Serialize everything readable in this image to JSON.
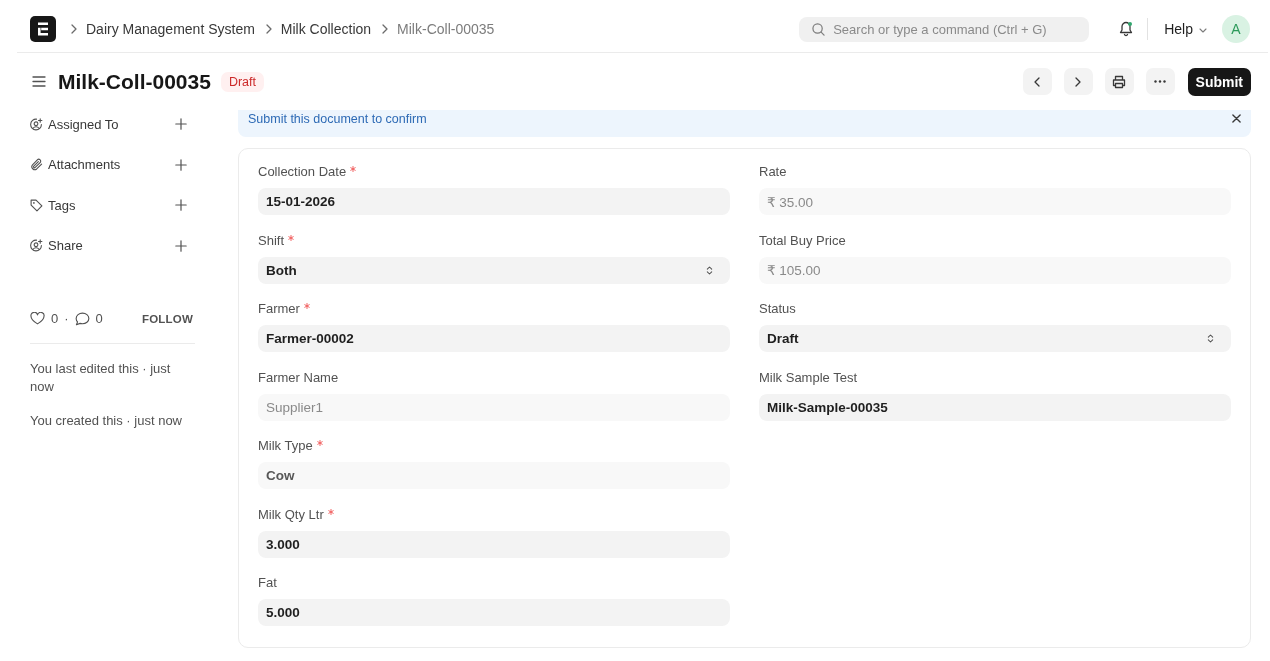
{
  "navbar": {
    "breadcrumbs": [
      {
        "label": "Dairy Management System",
        "current": false
      },
      {
        "label": "Milk Collection",
        "current": false
      },
      {
        "label": "Milk-Coll-00035",
        "current": true
      }
    ],
    "search": {
      "placeholder": "Search or type a command (Ctrl + G)"
    },
    "notifications": {
      "unread": true
    },
    "help": "Help",
    "avatar": "A"
  },
  "page_head": {
    "title": "Milk-Coll-00035",
    "status": "Draft",
    "primary_action": "Submit"
  },
  "sidebar": {
    "items": [
      {
        "kind": "assign",
        "label": "Assigned To"
      },
      {
        "kind": "attachment",
        "label": "Attachments"
      },
      {
        "kind": "tag",
        "label": "Tags"
      },
      {
        "kind": "share",
        "label": "Share"
      }
    ],
    "likes": "0",
    "separator": "·",
    "comments": "0",
    "follow": "FOLLOW",
    "activity": [
      "You last edited this · just now",
      "You created this · just now"
    ]
  },
  "alert": {
    "message": "Submit this document to confirm"
  },
  "form": {
    "columns": [
      {
        "fields": [
          {
            "label": "Collection Date",
            "value": "15-01-2026",
            "kind": "text",
            "required": true,
            "read_only": false,
            "emphasized": true
          },
          {
            "label": "Shift",
            "value": "Both",
            "kind": "select",
            "required": true,
            "read_only": false,
            "emphasized": true
          },
          {
            "label": "Farmer",
            "value": "Farmer-00002",
            "kind": "text",
            "required": true,
            "read_only": false,
            "emphasized": true
          },
          {
            "label": "Farmer Name",
            "value": "Supplier1",
            "kind": "text",
            "required": false,
            "read_only": true,
            "emphasized": false
          },
          {
            "label": "Milk Type",
            "value": "Cow",
            "kind": "text",
            "required": true,
            "read_only": true,
            "emphasized": true
          },
          {
            "label": "Milk Qty Ltr",
            "value": "3.000",
            "kind": "text",
            "required": true,
            "read_only": false,
            "emphasized": true
          },
          {
            "label": "Fat",
            "value": "5.000",
            "kind": "text",
            "required": false,
            "read_only": false,
            "emphasized": true
          }
        ]
      },
      {
        "fields": [
          {
            "label": "Rate",
            "value": "₹ 35.00",
            "kind": "text",
            "required": false,
            "read_only": true,
            "emphasized": false
          },
          {
            "label": "Total Buy Price",
            "value": "₹ 105.00",
            "kind": "text",
            "required": false,
            "read_only": true,
            "emphasized": false
          },
          {
            "label": "Status",
            "value": "Draft",
            "kind": "select",
            "required": false,
            "read_only": false,
            "emphasized": true
          },
          {
            "label": "Milk Sample Test",
            "value": "Milk-Sample-00035",
            "kind": "text",
            "required": false,
            "read_only": false,
            "emphasized": true
          }
        ]
      }
    ]
  }
}
